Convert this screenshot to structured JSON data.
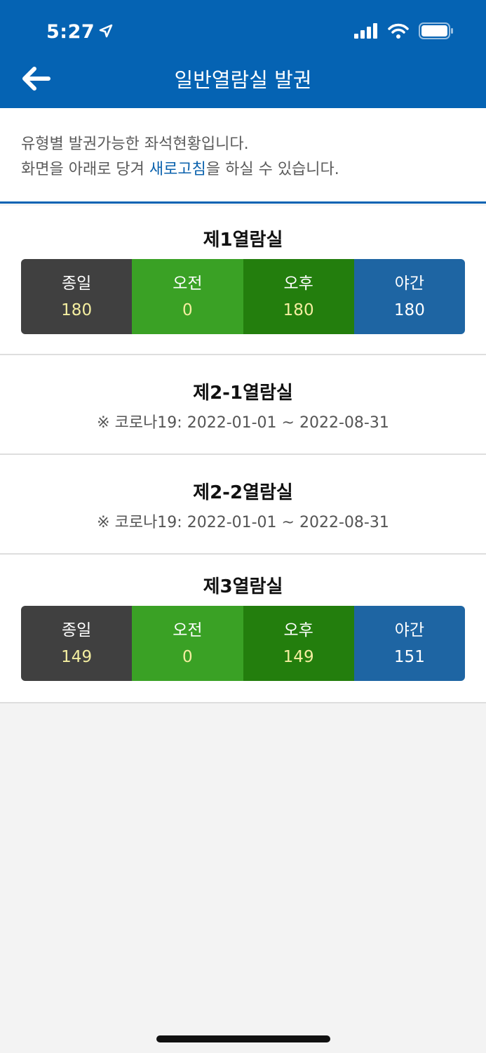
{
  "status_bar": {
    "time": "5:27"
  },
  "header": {
    "title": "일반열람실 발권"
  },
  "info": {
    "line1": "유형별 발권가능한 좌석현황입니다.",
    "line2_prefix": "화면을 아래로 당겨 ",
    "line2_link": "새로고침",
    "line2_suffix": "을 하실 수 있습니다."
  },
  "rooms": [
    {
      "name": "제1열람실",
      "seats": [
        {
          "label": "종일",
          "value": "180"
        },
        {
          "label": "오전",
          "value": "0"
        },
        {
          "label": "오후",
          "value": "180"
        },
        {
          "label": "야간",
          "value": "180"
        }
      ]
    },
    {
      "name": "제2-1열람실",
      "note": "※ 코로나19: 2022-01-01 ~ 2022-08-31"
    },
    {
      "name": "제2-2열람실",
      "note": "※ 코로나19: 2022-01-01 ~ 2022-08-31"
    },
    {
      "name": "제3열람실",
      "seats": [
        {
          "label": "종일",
          "value": "149"
        },
        {
          "label": "오전",
          "value": "0"
        },
        {
          "label": "오후",
          "value": "149"
        },
        {
          "label": "야간",
          "value": "151"
        }
      ]
    }
  ]
}
